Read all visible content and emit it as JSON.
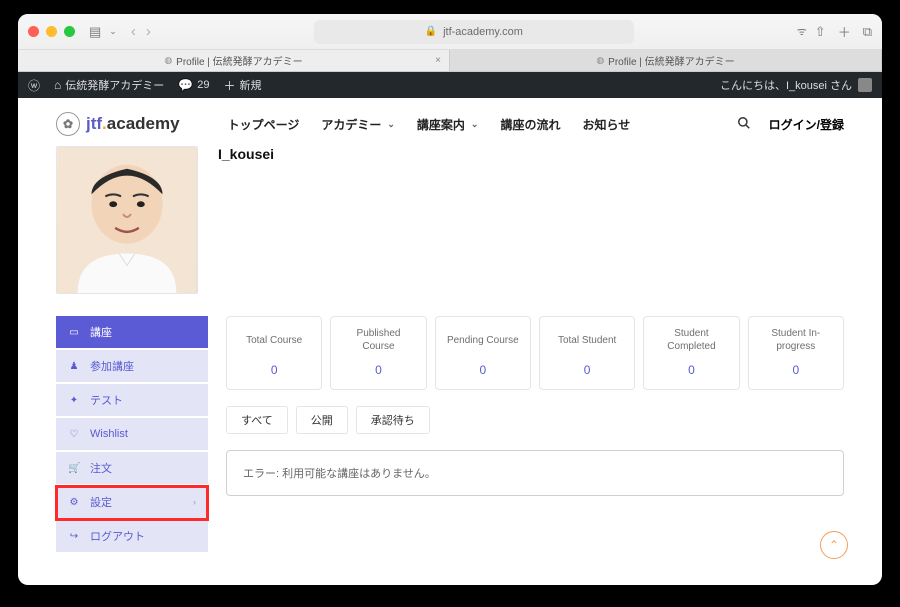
{
  "browser": {
    "url": "jtf-academy.com",
    "tabs": [
      {
        "title": "Profile | 伝統発酵アカデミー",
        "active": true
      },
      {
        "title": "Profile | 伝統発酵アカデミー",
        "active": false
      }
    ]
  },
  "wp": {
    "site_name": "伝統発酵アカデミー",
    "comments_count": "29",
    "new_label": "新規",
    "greeting": "こんにちは、I_kousei さん"
  },
  "header": {
    "logo_main": "jtf",
    "logo_sub": "academy",
    "nav": {
      "top": "トップページ",
      "academy": "アカデミー",
      "courses": "講座案内",
      "flow": "講座の流れ",
      "news": "お知らせ"
    },
    "login": "ログイン/登録"
  },
  "profile": {
    "username": "I_kousei"
  },
  "sidebar": {
    "items": [
      {
        "label": "講座"
      },
      {
        "label": "参加講座"
      },
      {
        "label": "テスト"
      },
      {
        "label": "Wishlist"
      },
      {
        "label": "注文"
      },
      {
        "label": "設定"
      },
      {
        "label": "ログアウト"
      }
    ]
  },
  "stats": [
    {
      "label": "Total Course",
      "value": "0"
    },
    {
      "label": "Published Course",
      "value": "0"
    },
    {
      "label": "Pending Course",
      "value": "0"
    },
    {
      "label": "Total Student",
      "value": "0"
    },
    {
      "label": "Student Completed",
      "value": "0"
    },
    {
      "label": "Student In-progress",
      "value": "0"
    }
  ],
  "filters": {
    "all": "すべて",
    "published": "公開",
    "pending": "承認待ち"
  },
  "error_message": "エラー: 利用可能な講座はありません。"
}
